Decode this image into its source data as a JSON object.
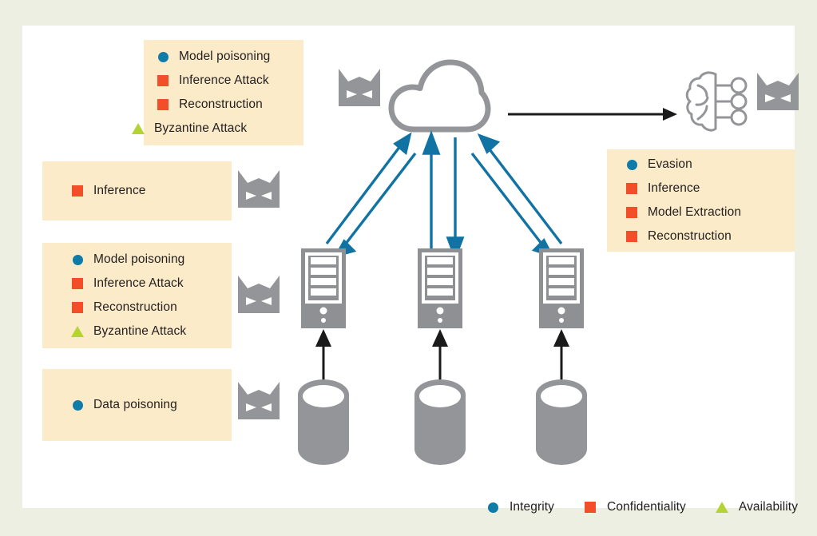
{
  "diagram": {
    "title": "Federated Learning Attack Surface",
    "colors": {
      "page_background": "#ecefe2",
      "panel_background": "#ffffff",
      "banner_fill": "#fbebc8",
      "integrity": "#0f7ba8",
      "confidentiality": "#f24e29",
      "availability": "#b5d334",
      "icon_gray": "#949599",
      "arrow_blue": "#1173a3",
      "arrow_black": "#1a1a1a"
    }
  },
  "banners": [
    {
      "id": "aggregator-attacks",
      "name": "aggregator-attack-banner",
      "items": [
        {
          "marker": "circle-icon",
          "category": "Integrity",
          "label": "Model poisoning"
        },
        {
          "marker": "square-icon",
          "category": "Confidentiality",
          "label": "Inference Attack"
        },
        {
          "marker": "square-icon",
          "category": "Confidentiality",
          "label": "Reconstruction"
        },
        {
          "marker": "triangle-icon",
          "category": "Availability",
          "label": "Byzantine Attack"
        }
      ]
    },
    {
      "id": "communication-attacks",
      "name": "communication-attack-banner",
      "items": [
        {
          "marker": "square-icon",
          "category": "Confidentiality",
          "label": "Inference"
        }
      ]
    },
    {
      "id": "client-attacks",
      "name": "client-attack-banner",
      "items": [
        {
          "marker": "circle-icon",
          "category": "Integrity",
          "label": "Model poisoning"
        },
        {
          "marker": "square-icon",
          "category": "Confidentiality",
          "label": "Inference Attack"
        },
        {
          "marker": "square-icon",
          "category": "Confidentiality",
          "label": "Reconstruction"
        },
        {
          "marker": "triangle-icon",
          "category": "Availability",
          "label": "Byzantine Attack"
        }
      ]
    },
    {
      "id": "data-attacks",
      "name": "data-attack-banner",
      "items": [
        {
          "marker": "circle-icon",
          "category": "Integrity",
          "label": "Data poisoning"
        }
      ]
    },
    {
      "id": "model-attacks",
      "name": "deployed-model-attack-banner",
      "items": [
        {
          "marker": "circle-icon",
          "category": "Integrity",
          "label": "Evasion"
        },
        {
          "marker": "square-icon",
          "category": "Confidentiality",
          "label": "Inference"
        },
        {
          "marker": "square-icon",
          "category": "Confidentiality",
          "label": "Model Extraction"
        },
        {
          "marker": "square-icon",
          "category": "Confidentiality",
          "label": "Reconstruction"
        }
      ]
    }
  ],
  "legend": {
    "items": [
      {
        "marker": "circle-icon",
        "label": "Integrity",
        "color": "#0f7ba8"
      },
      {
        "marker": "square-icon",
        "label": "Confidentiality",
        "color": "#f24e29"
      },
      {
        "marker": "triangle-icon",
        "label": "Availability",
        "color": "#b5d334"
      }
    ]
  },
  "nodes": {
    "cloud": {
      "name": "cloud-aggregator-icon",
      "label": "Cloud aggregation server"
    },
    "brain": {
      "name": "neural-network-model-icon",
      "label": "Deployed model"
    },
    "servers": [
      {
        "name": "client-server-icon-1",
        "label": "Client 1"
      },
      {
        "name": "client-server-icon-2",
        "label": "Client 2"
      },
      {
        "name": "client-server-icon-3",
        "label": "Client 3"
      }
    ],
    "databases": [
      {
        "name": "database-icon-1",
        "label": "Data store 1"
      },
      {
        "name": "database-icon-2",
        "label": "Data store 2"
      },
      {
        "name": "database-icon-3",
        "label": "Data store 3"
      }
    ],
    "attackers": [
      {
        "name": "attacker-mask-icon-cloud",
        "label": "Attacker at aggregator"
      },
      {
        "name": "attacker-mask-icon-model",
        "label": "Attacker at deployed model"
      },
      {
        "name": "attacker-mask-icon-communication",
        "label": "Attacker on communication channel"
      },
      {
        "name": "attacker-mask-icon-client",
        "label": "Attacker at client"
      },
      {
        "name": "attacker-mask-icon-data",
        "label": "Attacker at data source"
      }
    ]
  }
}
